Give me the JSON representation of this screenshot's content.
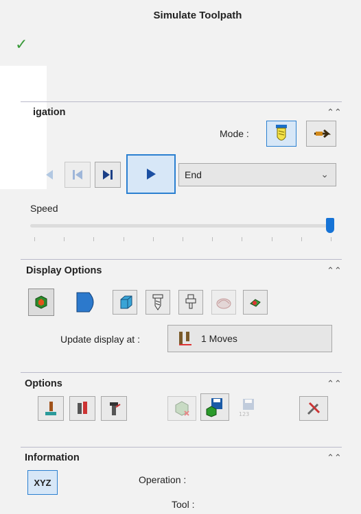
{
  "panel": {
    "title": "Simulate Toolpath",
    "ok_icon": "checkmark-icon"
  },
  "navigation": {
    "title": "igation",
    "mode_label": "Mode :",
    "mode_buttons": [
      "tool-mode-icon",
      "fly-mode-icon"
    ],
    "playback_buttons": [
      "previous-icon",
      "go-to-start-icon",
      "next-step-icon",
      "play-icon"
    ],
    "stop_at": {
      "value": "End"
    },
    "speed_label": "Speed",
    "speed_level": 1.0
  },
  "display_options": {
    "title": "Display Options",
    "buttons": [
      "stock-display-icon",
      "part-display-icon",
      "solid-display-icon",
      "tool-display-icon",
      "holder-display-icon",
      "toolpath-display-icon",
      "fixture-display-icon"
    ],
    "update_label": "Update display at :",
    "update_value": "1 Moves"
  },
  "options": {
    "title": "Options",
    "buttons": [
      "option-1-icon",
      "option-2-icon",
      "option-3-icon",
      "compare-icon",
      "save-stock-icon",
      "save-stl-icon",
      "settings-icon"
    ]
  },
  "information": {
    "title": "Information",
    "xyz_label": "XYZ",
    "operation_label": "Operation :",
    "tool_label": "Tool :"
  },
  "colors": {
    "accent": "#1673d6",
    "check": "#3a9a3a",
    "selected_bg": "#d7e7f7"
  }
}
